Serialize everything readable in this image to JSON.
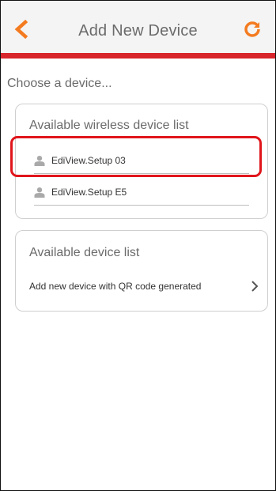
{
  "header": {
    "title": "Add New Device",
    "back_icon": "chevron-left-icon",
    "refresh_icon": "refresh-icon",
    "accent_color": "#f47b20",
    "bar_color": "#d8242b"
  },
  "main": {
    "prompt": "Choose a device...",
    "wireless_section": {
      "title": "Available wireless device list",
      "devices": [
        {
          "label": "EdiView.Setup 03",
          "icon": "person-icon",
          "highlighted": true
        },
        {
          "label": "EdiView.Setup E5",
          "icon": "person-icon",
          "highlighted": false
        }
      ]
    },
    "device_section": {
      "title": "Available device list",
      "items": [
        {
          "label": "Add new device with QR code generated",
          "icon": "chevron-right-icon"
        }
      ]
    },
    "highlight_color": "#e0151b"
  }
}
